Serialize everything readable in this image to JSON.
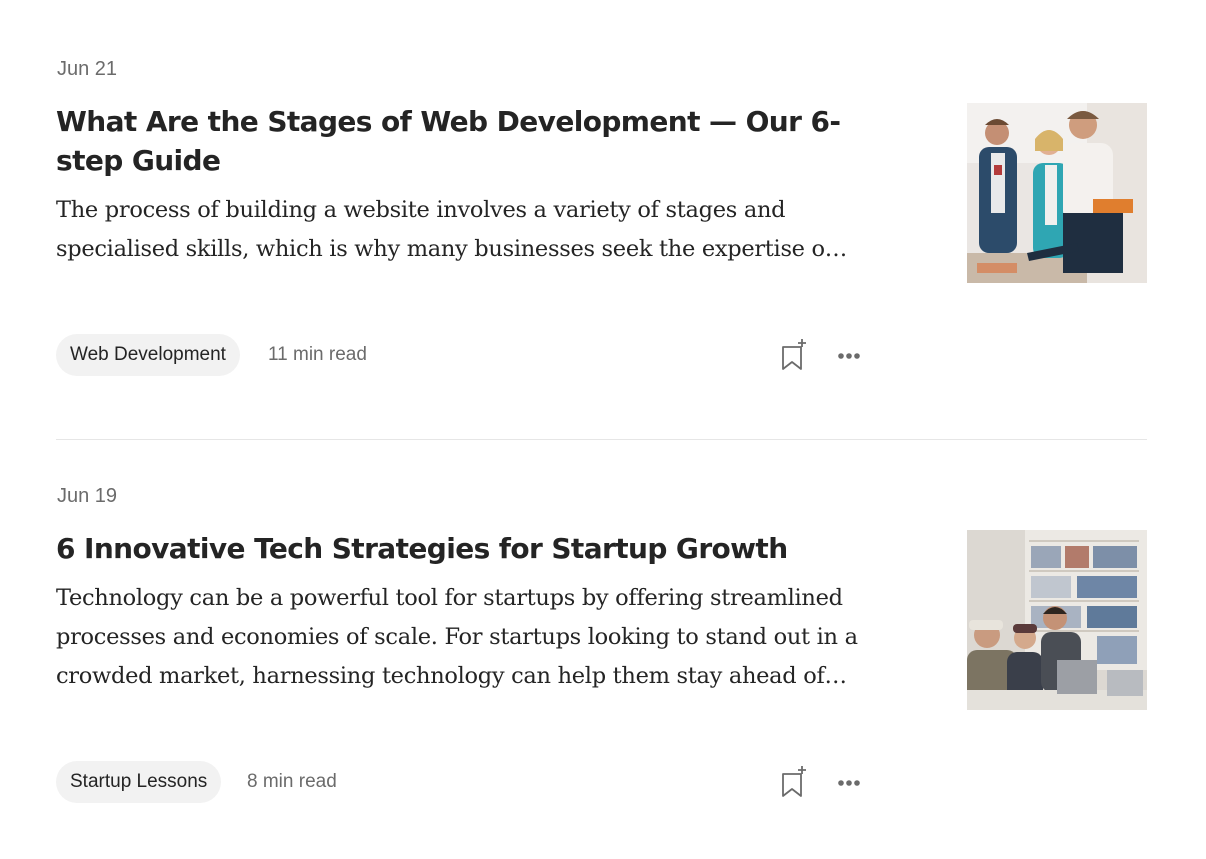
{
  "articles": [
    {
      "date": "Jun 21",
      "title": "What Are the Stages of Web Development — Our 6-step Guide",
      "snippet": "The process of building a website involves a variety of stages and specialised skills, which is why many businesses seek the expertise o…",
      "tag": "Web Development",
      "read_time": "11 min read",
      "thumbnail_icon": "team-at-table-photo"
    },
    {
      "date": "Jun 19",
      "title": "6 Innovative Tech Strategies for Startup Growth",
      "snippet": "Technology can be a powerful tool for startups by offering streamlined processes and economies of scale. For startups looking to stand out in a crowded market, harnessing technology can help them stay ahead of…",
      "tag": "Startup Lessons",
      "read_time": "8 min read",
      "thumbnail_icon": "people-with-laptops-photo"
    }
  ],
  "icons": {
    "bookmark": "bookmark-add-icon",
    "more": "more-options-icon"
  }
}
